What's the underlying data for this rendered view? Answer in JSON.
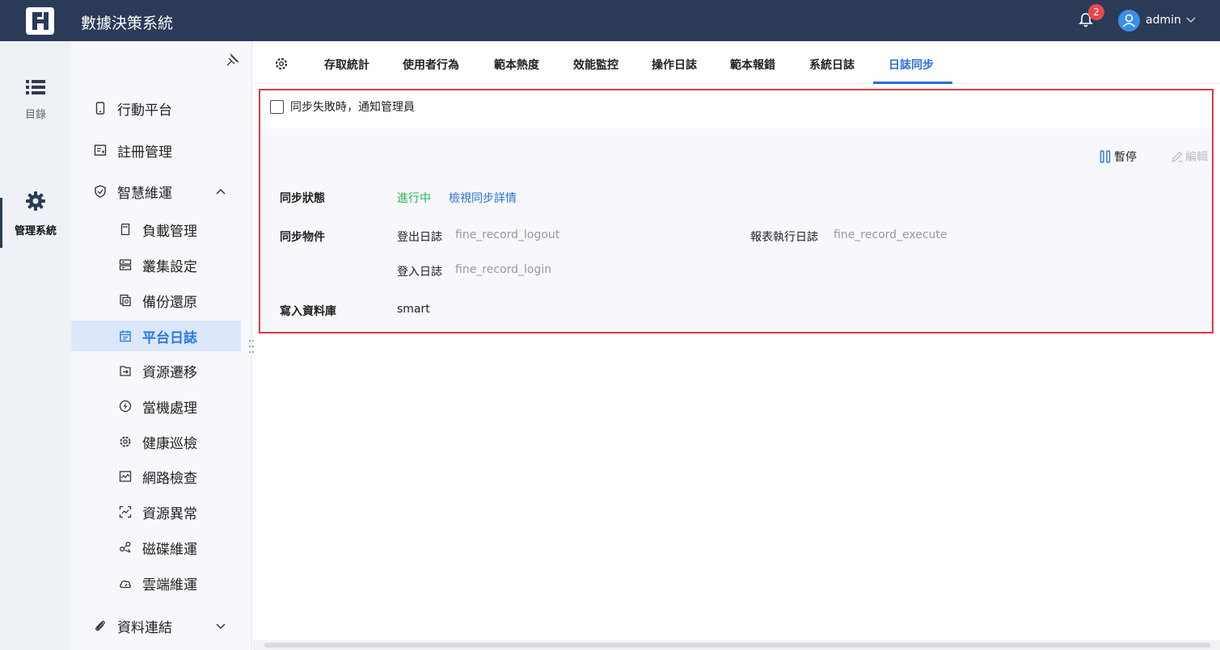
{
  "header": {
    "app_title": "數據決策系統",
    "notification_count": "2",
    "user_name": "admin"
  },
  "rail": {
    "items": [
      {
        "label": "目錄",
        "icon": "list-icon"
      },
      {
        "label": "管理系統",
        "icon": "gear-icon",
        "active": true
      }
    ]
  },
  "submenu": {
    "items": [
      {
        "label": "行動平台",
        "icon": "mobile-icon",
        "level": 1
      },
      {
        "label": "註冊管理",
        "icon": "register-icon",
        "level": 1
      },
      {
        "label": "智慧維運",
        "icon": "shield-icon",
        "level": 1,
        "expanded": true
      },
      {
        "label": "負載管理",
        "icon": "sd-card-icon",
        "level": 2
      },
      {
        "label": "叢集設定",
        "icon": "server-icon",
        "level": 2
      },
      {
        "label": "備份還原",
        "icon": "backup-icon",
        "level": 2
      },
      {
        "label": "平台日誌",
        "icon": "calendar-icon",
        "level": 2,
        "selected": true
      },
      {
        "label": "資源遷移",
        "icon": "migrate-icon",
        "level": 2
      },
      {
        "label": "當機處理",
        "icon": "lightning-icon",
        "level": 2
      },
      {
        "label": "健康巡檢",
        "icon": "health-gear-icon",
        "level": 2
      },
      {
        "label": "網路檢查",
        "icon": "network-icon",
        "level": 2
      },
      {
        "label": "資源異常",
        "icon": "scan-icon",
        "level": 2
      },
      {
        "label": "磁碟維運",
        "icon": "share-icon",
        "level": 2
      },
      {
        "label": "雲端維運",
        "icon": "cloud-gauge-icon",
        "level": 2
      },
      {
        "label": "資料連結",
        "icon": "paperclip-icon",
        "level": 1,
        "expanded": false
      }
    ]
  },
  "tabs": [
    {
      "label": "存取統計"
    },
    {
      "label": "使用者行為"
    },
    {
      "label": "範本熱度"
    },
    {
      "label": "效能監控"
    },
    {
      "label": "操作日誌"
    },
    {
      "label": "範本報錯"
    },
    {
      "label": "系統日誌"
    },
    {
      "label": "日誌同步",
      "active": true
    }
  ],
  "sync": {
    "notify_label": "同步失敗時，通知管理員",
    "pause_label": "暫停",
    "edit_label": "編輯",
    "status_label": "同步狀態",
    "status_value": "進行中",
    "status_link": "檢視同步詳情",
    "objects_label": "同步物件",
    "objects": [
      {
        "name": "登出日誌",
        "table": "fine_record_logout"
      },
      {
        "name": "報表執行日誌",
        "table": "fine_record_execute"
      },
      {
        "name": "登入日誌",
        "table": "fine_record_login"
      }
    ],
    "db_label": "寫入資料庫",
    "db_value": "smart"
  },
  "colors": {
    "header_bg": "#2b3a57",
    "accent": "#2b6fd6",
    "status_green": "#2ab353",
    "highlight_border": "#e5393f"
  }
}
